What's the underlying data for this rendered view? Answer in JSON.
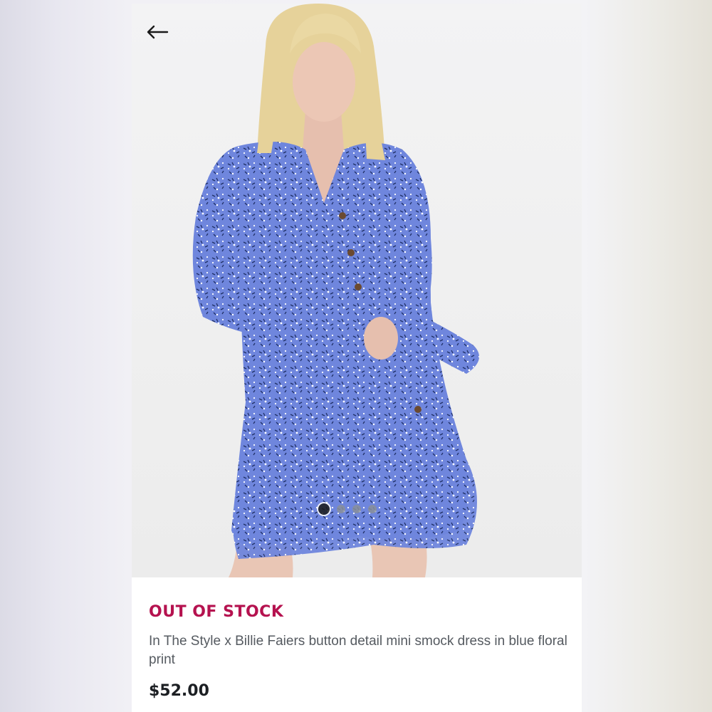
{
  "header": {
    "back_icon": "arrow-left-icon"
  },
  "gallery": {
    "image_count": 4,
    "active_index": 0,
    "dress_color": "#6f86dd"
  },
  "product": {
    "stock_status": "OUT OF STOCK",
    "title": "In The Style x Billie Faiers button detail mini smock dress in blue floral print",
    "price": "$52.00"
  },
  "colors": {
    "stock_status": "#b5124f",
    "price": "#1c1f23",
    "title": "#555a60"
  }
}
